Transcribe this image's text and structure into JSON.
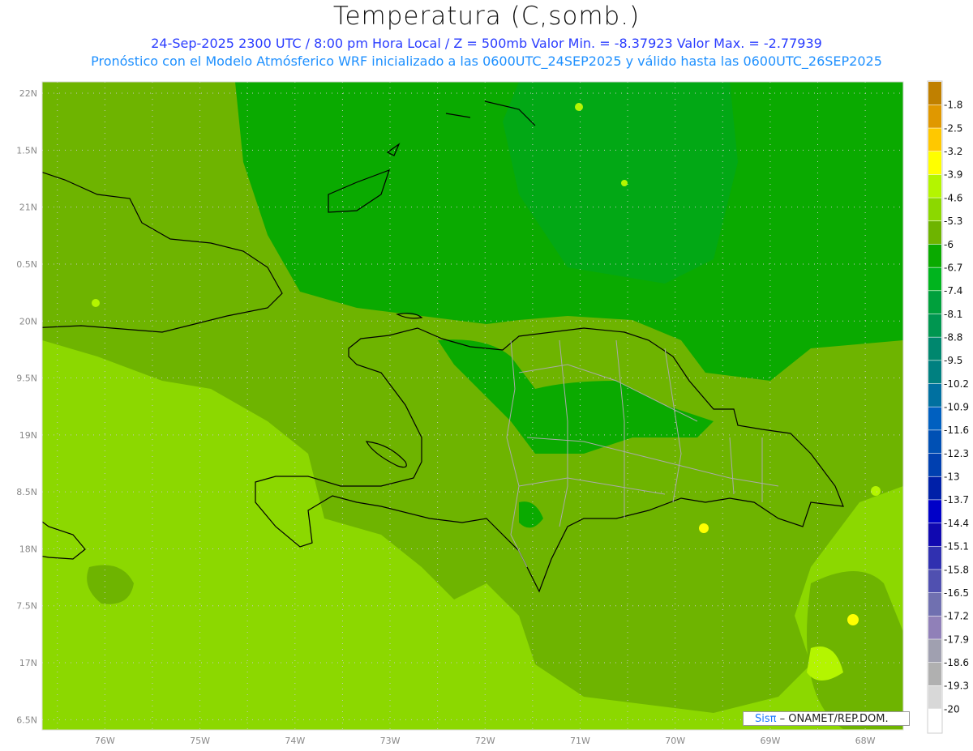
{
  "header": {
    "title": "Temperatura (C,somb.)",
    "subtitle_line1": "24-Sep-2025  2300 UTC / 8:00 pm Hora Local / Z = 500mb  Valor Min. = -8.37923  Valor Max. = -2.77939",
    "subtitle_line2": "Pronóstico con el Modelo Atmósferico WRF inicializado a las 0600UTC_24SEP2025 y válido hasta las  0600UTC_26SEP2025"
  },
  "map": {
    "lon_range": [
      -76.66,
      -67.6
    ],
    "lat_range": [
      16.41,
      22.1
    ],
    "lon_ticks": [
      {
        "value": -76,
        "label": "76W"
      },
      {
        "value": -75,
        "label": "75W"
      },
      {
        "value": -74,
        "label": "74W"
      },
      {
        "value": -73,
        "label": "73W"
      },
      {
        "value": -72,
        "label": "72W"
      },
      {
        "value": -71,
        "label": "71W"
      },
      {
        "value": -70,
        "label": "70W"
      },
      {
        "value": -69,
        "label": "69W"
      },
      {
        "value": -68,
        "label": "68W"
      }
    ],
    "lat_ticks": [
      {
        "value": 22,
        "label": "22N"
      },
      {
        "value": 21.5,
        "label": "1.5N"
      },
      {
        "value": 21,
        "label": "21N"
      },
      {
        "value": 20.5,
        "label": "0.5N"
      },
      {
        "value": 20,
        "label": "20N"
      },
      {
        "value": 19.5,
        "label": "9.5N"
      },
      {
        "value": 19,
        "label": "19N"
      },
      {
        "value": 18.5,
        "label": "8.5N"
      },
      {
        "value": 18,
        "label": "18N"
      },
      {
        "value": 17.5,
        "label": "7.5N"
      },
      {
        "value": 17,
        "label": "17N"
      },
      {
        "value": 16.5,
        "label": "6.5N"
      }
    ]
  },
  "colorbar": {
    "labels": [
      "-1.8",
      "-2.5",
      "-3.2",
      "-3.9",
      "-4.6",
      "-5.3",
      "-6",
      "-6.7",
      "-7.4",
      "-8.1",
      "-8.8",
      "-9.5",
      "-10.2",
      "-10.9",
      "-11.6",
      "-12.3",
      "-13",
      "-13.7",
      "-14.4",
      "-15.1",
      "-15.8",
      "-16.5",
      "-17.2",
      "-17.9",
      "-18.6",
      "-19.3",
      "-20"
    ],
    "colors": [
      "#c08000",
      "#e09800",
      "#ffc800",
      "#ffff00",
      "#b4f500",
      "#8cd800",
      "#6eb400",
      "#0aaa00",
      "#00b41e",
      "#00a03c",
      "#009650",
      "#00876e",
      "#008080",
      "#0070a0",
      "#0060c0",
      "#0050b4",
      "#0040b0",
      "#0020a8",
      "#0000c8",
      "#1008b0",
      "#3030b0",
      "#5050b0",
      "#7070b0",
      "#9080b8",
      "#a0a0b0",
      "#b0b0b0",
      "#d8d8d8",
      "#ffffff"
    ]
  },
  "credit": {
    "brand": "Sisπ",
    "text": "– ONAMET/REP.DOM."
  }
}
